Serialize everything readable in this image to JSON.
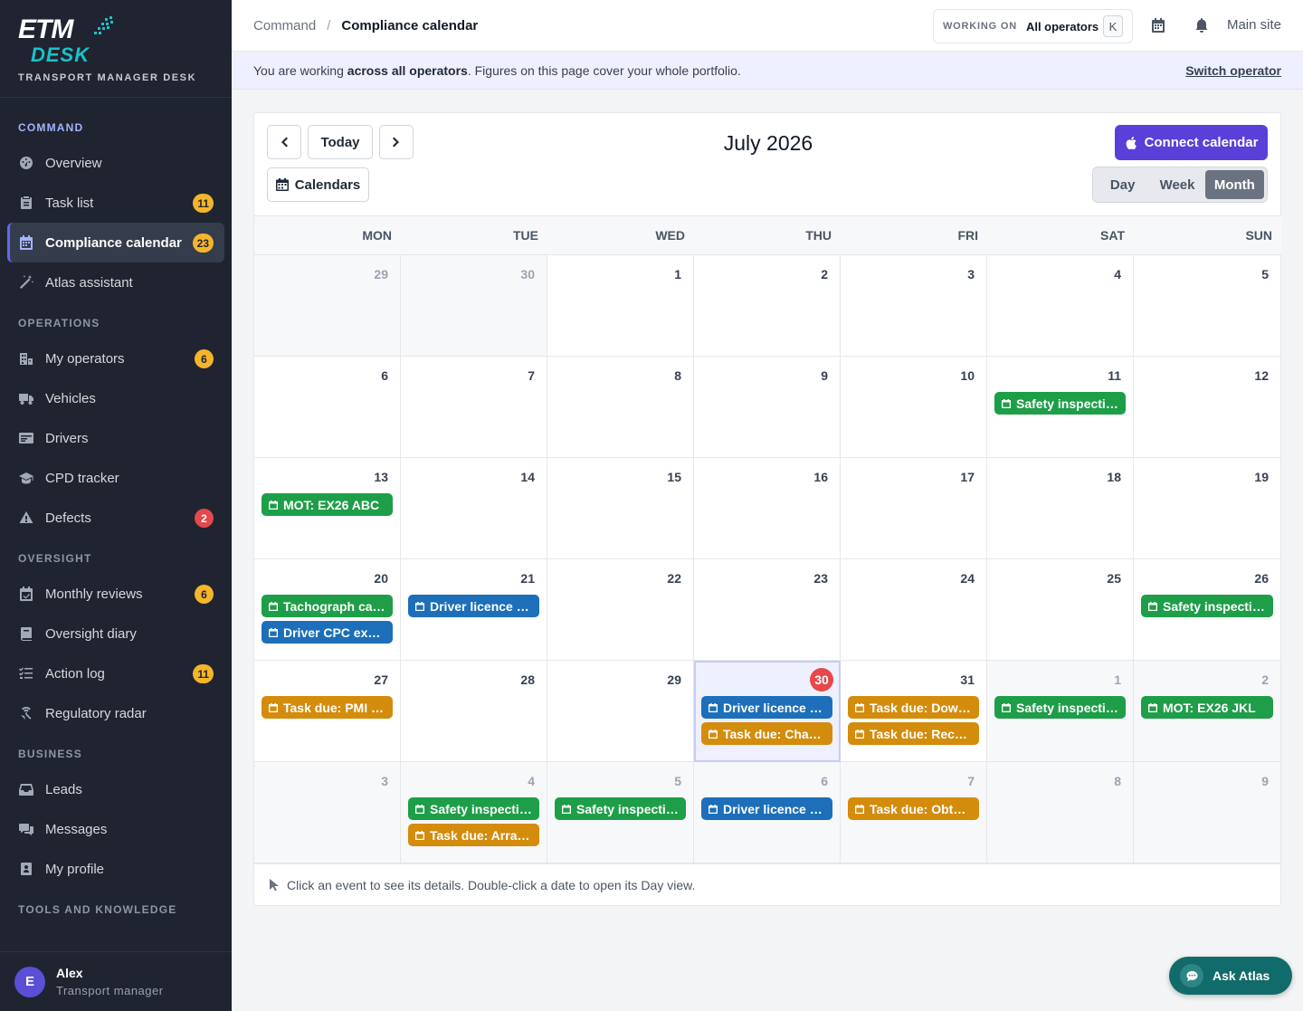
{
  "brand": {
    "logo_text": "ETM",
    "logo_sub": "DESK",
    "tagline": "TRANSPORT MANAGER DESK"
  },
  "sidebar": {
    "sections": [
      {
        "title": "COMMAND",
        "active": true,
        "items": [
          {
            "label": "Overview",
            "icon": "overview-icon",
            "badge": null
          },
          {
            "label": "Task list",
            "icon": "clipboard-icon",
            "badge": "11",
            "badge_color": "yellow"
          },
          {
            "label": "Compliance calendar",
            "icon": "calendar-icon",
            "badge": "23",
            "badge_color": "yellow",
            "active": true
          },
          {
            "label": "Atlas assistant",
            "icon": "magic-wand-icon",
            "badge": null
          }
        ]
      },
      {
        "title": "OPERATIONS",
        "items": [
          {
            "label": "My operators",
            "icon": "building-icon",
            "badge": "6",
            "badge_color": "yellow"
          },
          {
            "label": "Vehicles",
            "icon": "truck-icon",
            "badge": null
          },
          {
            "label": "Drivers",
            "icon": "id-card-icon",
            "badge": null
          },
          {
            "label": "CPD tracker",
            "icon": "graduation-cap-icon",
            "badge": null
          },
          {
            "label": "Defects",
            "icon": "warning-icon",
            "badge": "2",
            "badge_color": "red"
          }
        ]
      },
      {
        "title": "OVERSIGHT",
        "items": [
          {
            "label": "Monthly reviews",
            "icon": "calendar-check-icon",
            "badge": "6",
            "badge_color": "yellow"
          },
          {
            "label": "Oversight diary",
            "icon": "book-icon",
            "badge": null
          },
          {
            "label": "Action log",
            "icon": "list-check-icon",
            "badge": "11",
            "badge_color": "yellow"
          },
          {
            "label": "Regulatory radar",
            "icon": "radar-icon",
            "badge": null
          }
        ]
      },
      {
        "title": "BUSINESS",
        "items": [
          {
            "label": "Leads",
            "icon": "inbox-icon",
            "badge": null
          },
          {
            "label": "Messages",
            "icon": "chat-icon",
            "badge": null
          },
          {
            "label": "My profile",
            "icon": "profile-icon",
            "badge": null
          }
        ]
      },
      {
        "title": "TOOLS AND KNOWLEDGE",
        "items": []
      }
    ],
    "user": {
      "initial": "E",
      "name": "Alex",
      "role": "Transport manager"
    }
  },
  "topbar": {
    "breadcrumb_root": "Command",
    "breadcrumb_sep": "/",
    "breadcrumb_current": "Compliance calendar",
    "working_label": "WORKING ON",
    "working_value": "All operators",
    "shortcut": "K",
    "site": "Main site"
  },
  "banner": {
    "text_before": "You are working ",
    "text_bold": "across all operators",
    "text_after": ". Figures on this page cover your whole portfolio.",
    "link": "Switch operator"
  },
  "calendar": {
    "title": "July 2026",
    "today_label": "Today",
    "calendars_label": "Calendars",
    "connect_label": "Connect calendar",
    "views": [
      "Day",
      "Week",
      "Month"
    ],
    "active_view": "Month",
    "weekdays": [
      "MON",
      "TUE",
      "WED",
      "THU",
      "FRI",
      "SAT",
      "SUN"
    ],
    "colors": {
      "green": "#1e9e48",
      "blue": "#1c6fb8",
      "amber": "#d48c0c",
      "today": "#e5484d"
    },
    "weeks": [
      [
        {
          "day": "29",
          "outside": true
        },
        {
          "day": "30",
          "outside": true
        },
        {
          "day": "1"
        },
        {
          "day": "2"
        },
        {
          "day": "3"
        },
        {
          "day": "4"
        },
        {
          "day": "5"
        }
      ],
      [
        {
          "day": "6"
        },
        {
          "day": "7"
        },
        {
          "day": "8"
        },
        {
          "day": "9"
        },
        {
          "day": "10"
        },
        {
          "day": "11",
          "events": [
            {
              "text": "Safety inspecti…",
              "color": "green"
            }
          ]
        },
        {
          "day": "12"
        }
      ],
      [
        {
          "day": "13",
          "events": [
            {
              "text": "MOT: EX26 ABC",
              "color": "green"
            }
          ]
        },
        {
          "day": "14"
        },
        {
          "day": "15"
        },
        {
          "day": "16"
        },
        {
          "day": "17"
        },
        {
          "day": "18"
        },
        {
          "day": "19"
        }
      ],
      [
        {
          "day": "20",
          "events": [
            {
              "text": "Tachograph ca…",
              "color": "green"
            },
            {
              "text": "Driver CPC exp…",
              "color": "blue"
            }
          ]
        },
        {
          "day": "21",
          "events": [
            {
              "text": "Driver licence …",
              "color": "blue"
            }
          ]
        },
        {
          "day": "22"
        },
        {
          "day": "23"
        },
        {
          "day": "24"
        },
        {
          "day": "25"
        },
        {
          "day": "26",
          "events": [
            {
              "text": "Safety inspecti…",
              "color": "green"
            }
          ]
        }
      ],
      [
        {
          "day": "27",
          "events": [
            {
              "text": "Task due: PMI …",
              "color": "amber"
            }
          ]
        },
        {
          "day": "28"
        },
        {
          "day": "29"
        },
        {
          "day": "30",
          "today": true,
          "events": [
            {
              "text": "Driver licence …",
              "color": "blue"
            },
            {
              "text": "Task due: Cha…",
              "color": "amber"
            }
          ]
        },
        {
          "day": "31",
          "events": [
            {
              "text": "Task due: Dow…",
              "color": "amber"
            },
            {
              "text": "Task due: Rec…",
              "color": "amber"
            }
          ]
        },
        {
          "day": "1",
          "outside": true,
          "events": [
            {
              "text": "Safety inspecti…",
              "color": "green"
            }
          ]
        },
        {
          "day": "2",
          "outside": true,
          "events": [
            {
              "text": "MOT: EX26 JKL",
              "color": "green"
            }
          ]
        }
      ],
      [
        {
          "day": "3",
          "outside": true
        },
        {
          "day": "4",
          "outside": true,
          "events": [
            {
              "text": "Safety inspecti…",
              "color": "green"
            },
            {
              "text": "Task due: Arra…",
              "color": "amber"
            }
          ]
        },
        {
          "day": "5",
          "outside": true,
          "events": [
            {
              "text": "Safety inspecti…",
              "color": "green"
            }
          ]
        },
        {
          "day": "6",
          "outside": true,
          "events": [
            {
              "text": "Driver licence …",
              "color": "blue"
            }
          ]
        },
        {
          "day": "7",
          "outside": true,
          "events": [
            {
              "text": "Task due: Obta…",
              "color": "amber"
            }
          ]
        },
        {
          "day": "8",
          "outside": true
        },
        {
          "day": "9",
          "outside": true
        }
      ]
    ],
    "hint": "Click an event to see its details. Double-click a date to open its Day view."
  },
  "ask_atlas": {
    "label": "Ask Atlas"
  }
}
